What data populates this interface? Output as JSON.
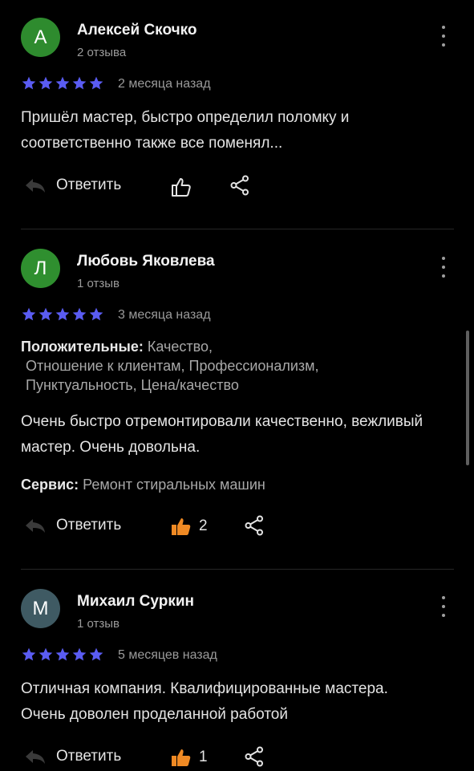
{
  "colors": {
    "star": "#5a5cf2",
    "like_active": "#f08a24",
    "avatar_1": "#2e8b2e",
    "avatar_2": "#2f8f2f",
    "avatar_3": "#3f5a63"
  },
  "reviews": [
    {
      "avatar_letter": "А",
      "name": "Алексей Скочко",
      "review_count": "2 отзыва",
      "rating": 5,
      "date": "2 месяца назад",
      "text": "Пришёл мастер, быстро определил поломку и соответственно также все поменял...",
      "reply_label": "Ответить",
      "likes": "",
      "liked": false
    },
    {
      "avatar_letter": "Л",
      "name": "Любовь Яковлева",
      "review_count": "1 отзыв",
      "rating": 5,
      "date": "3 месяца назад",
      "positives_label": "Положительные:",
      "positives_line1": "Качество,",
      "positives_line2": "Отношение к клиентам, Профессионализм,",
      "positives_line3": "Пунктуальность, Цена/качество",
      "text": "Очень быстро отремонтировали качественно, вежливый мастер. Очень довольна.",
      "service_label": "Сервис:",
      "service_value": "Ремонт стиральных машин",
      "reply_label": "Ответить",
      "likes": "2",
      "liked": true
    },
    {
      "avatar_letter": "М",
      "name": "Михаил Суркин",
      "review_count": "1 отзыв",
      "rating": 5,
      "date": "5 месяцев назад",
      "text": "Отличная компания. Квалифицированные мастера. Очень доволен проделанной работой",
      "reply_label": "Ответить",
      "likes": "1",
      "liked": true
    }
  ],
  "icons": {
    "more": "more-vertical-icon",
    "reply": "reply-arrow-icon",
    "like": "thumbs-up-icon",
    "share": "share-icon",
    "star": "star-icon"
  }
}
